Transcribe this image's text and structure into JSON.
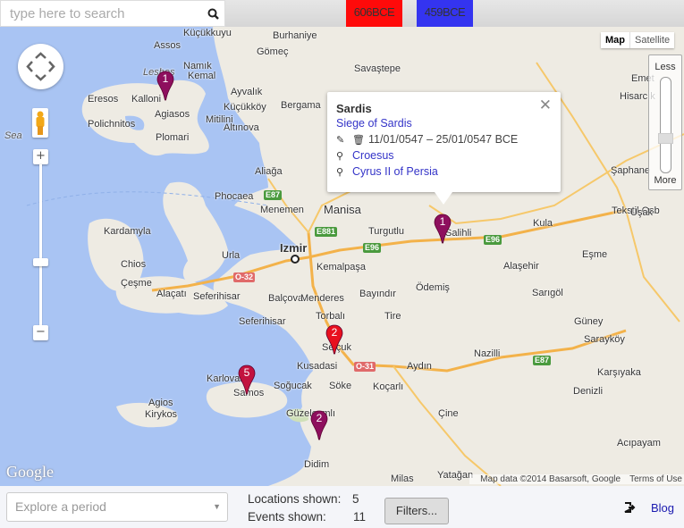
{
  "search": {
    "placeholder": "type here to search"
  },
  "timeline": {
    "start_label": "606BCE",
    "start_color": "#ff0a0a",
    "end_label": "459BCE",
    "end_color": "#3434f0"
  },
  "map": {
    "type_buttons": [
      "Map",
      "Satellite"
    ],
    "active_type": "Map",
    "density": {
      "less": "Less",
      "more": "More",
      "level": 0.72
    },
    "places": [
      "Küçükkuyu",
      "Burhaniye",
      "Assos",
      "Gömeç",
      "Savaştepe",
      "Namık",
      "Kemal",
      "Ayvalık",
      "Küçükköy",
      "Lesbos",
      "Kalloni",
      "Eresos",
      "Agiasos",
      "Mitilini",
      "Altınova",
      "Polichnitos",
      "Plomari",
      "Sea",
      "Bergama",
      "Aliağa",
      "Phocaea",
      "Menemen",
      "Manisa",
      "Turgutlu",
      "Salihli",
      "Kula",
      "Tekstil Osb",
      "Eşme",
      "Alaşehir",
      "Kardamyla",
      "Chios",
      "Çeşme",
      "Urla",
      "Izmir",
      "Kemalpaşa",
      "Alaçatı",
      "Seferihisar",
      "Balçova",
      "Menderes",
      "Ödemiş",
      "Sarıgöl",
      "Bayındır",
      "Seferihisar",
      "Torbalı",
      "Tire",
      "Güney",
      "Selçuk",
      "Sarayköy",
      "Kusadasi",
      "Aydın",
      "Nazilli",
      "Karşıyaka",
      "Karlovasi",
      "Samos",
      "Soğucak",
      "Söke",
      "Koçarlı",
      "Denizli",
      "Agios",
      "Kirykos",
      "Güzelçamlı",
      "Çine",
      "Acıpayam",
      "Didim",
      "Milas",
      "Yatağan",
      "Emet",
      "Hisarcık",
      "Şaphane",
      "Uşak"
    ],
    "roads": [
      "E87",
      "E881",
      "E96",
      "E96",
      "O-32",
      "O-31",
      "E87"
    ],
    "markers": [
      {
        "count": "1",
        "color": "#8e0f5e"
      },
      {
        "count": "1",
        "color": "#8e0f5e"
      },
      {
        "count": "2",
        "color": "#e8101e"
      },
      {
        "count": "5",
        "color": "#c2123e"
      },
      {
        "count": "2",
        "color": "#8e0f5e"
      }
    ],
    "attribution": "Map data ©2014 Basarsoft, Google",
    "terms": "Terms of Use",
    "logo": "Google"
  },
  "popup": {
    "title": "Sardis",
    "event": "Siege of Sardis",
    "dates": "11/01/0547 – 25/01/0547 BCE",
    "people": [
      "Croesus",
      "Cyrus II of Persia"
    ]
  },
  "footer": {
    "period_placeholder": "Explore a period",
    "locations_label": "Locations shown:",
    "locations_value": "5",
    "events_label": "Events shown:",
    "events_value": "11",
    "filters_label": "Filters...",
    "blog_label": "Blog"
  }
}
